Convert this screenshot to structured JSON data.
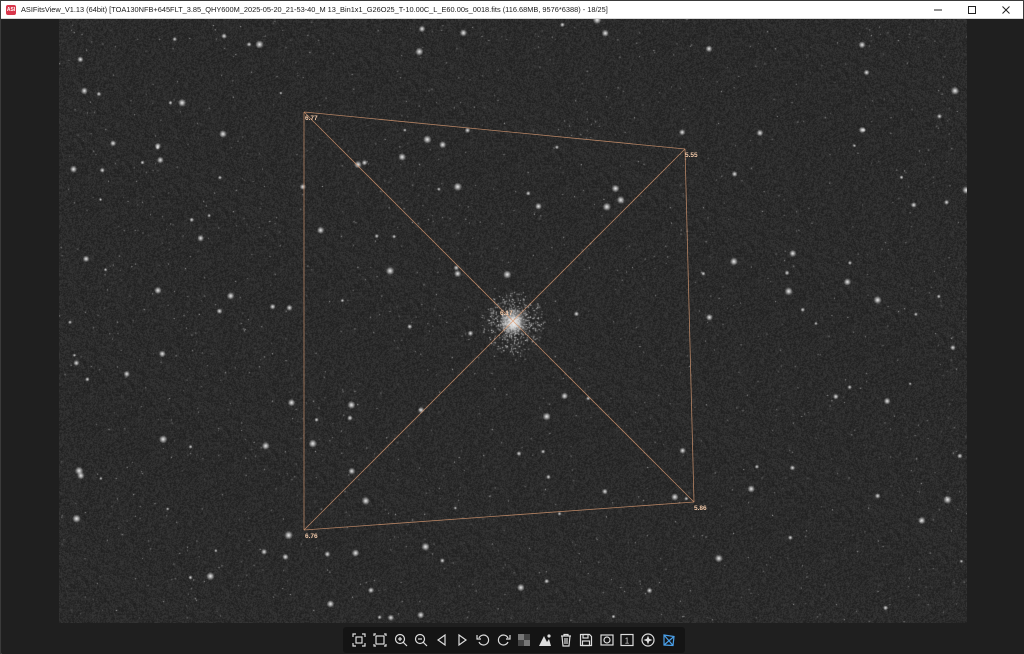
{
  "window": {
    "title": "ASIFitsView_V1.13 (64bit) [TOA130NFB+645FLT_3.85_QHY600M_2025-05-20_21-53-40_M 13_Bin1x1_G26O25_T-10.00C_L_E60.00s_0018.fits (116.68MB, 9576*6388) - 18/25]",
    "app_icon_text": "ASI",
    "controls": [
      "minimize-icon",
      "maximize-icon",
      "close-icon"
    ]
  },
  "analysis_overlay": {
    "color": "#d89a72",
    "corner_values": {
      "top_left": "6.77",
      "top_right": "5.55",
      "center": "6.17",
      "bottom_right": "5.86",
      "bottom_left": "6.76"
    }
  },
  "toolbar": {
    "buttons": [
      {
        "name": "fit-to-window-icon"
      },
      {
        "name": "actual-size-icon"
      },
      {
        "name": "zoom-in-icon"
      },
      {
        "name": "zoom-out-icon"
      },
      {
        "name": "previous-image-icon"
      },
      {
        "name": "next-image-icon"
      },
      {
        "name": "rotate-left-icon"
      },
      {
        "name": "rotate-right-icon"
      },
      {
        "name": "stretch-icon"
      },
      {
        "name": "histogram-icon"
      },
      {
        "name": "delete-icon"
      },
      {
        "name": "save-icon"
      },
      {
        "name": "debayer-icon"
      },
      {
        "name": "one-to-one-icon",
        "label": "1"
      },
      {
        "name": "star-detect-icon"
      },
      {
        "name": "tilt-analysis-icon"
      }
    ],
    "accent": "#4a9fe8"
  }
}
